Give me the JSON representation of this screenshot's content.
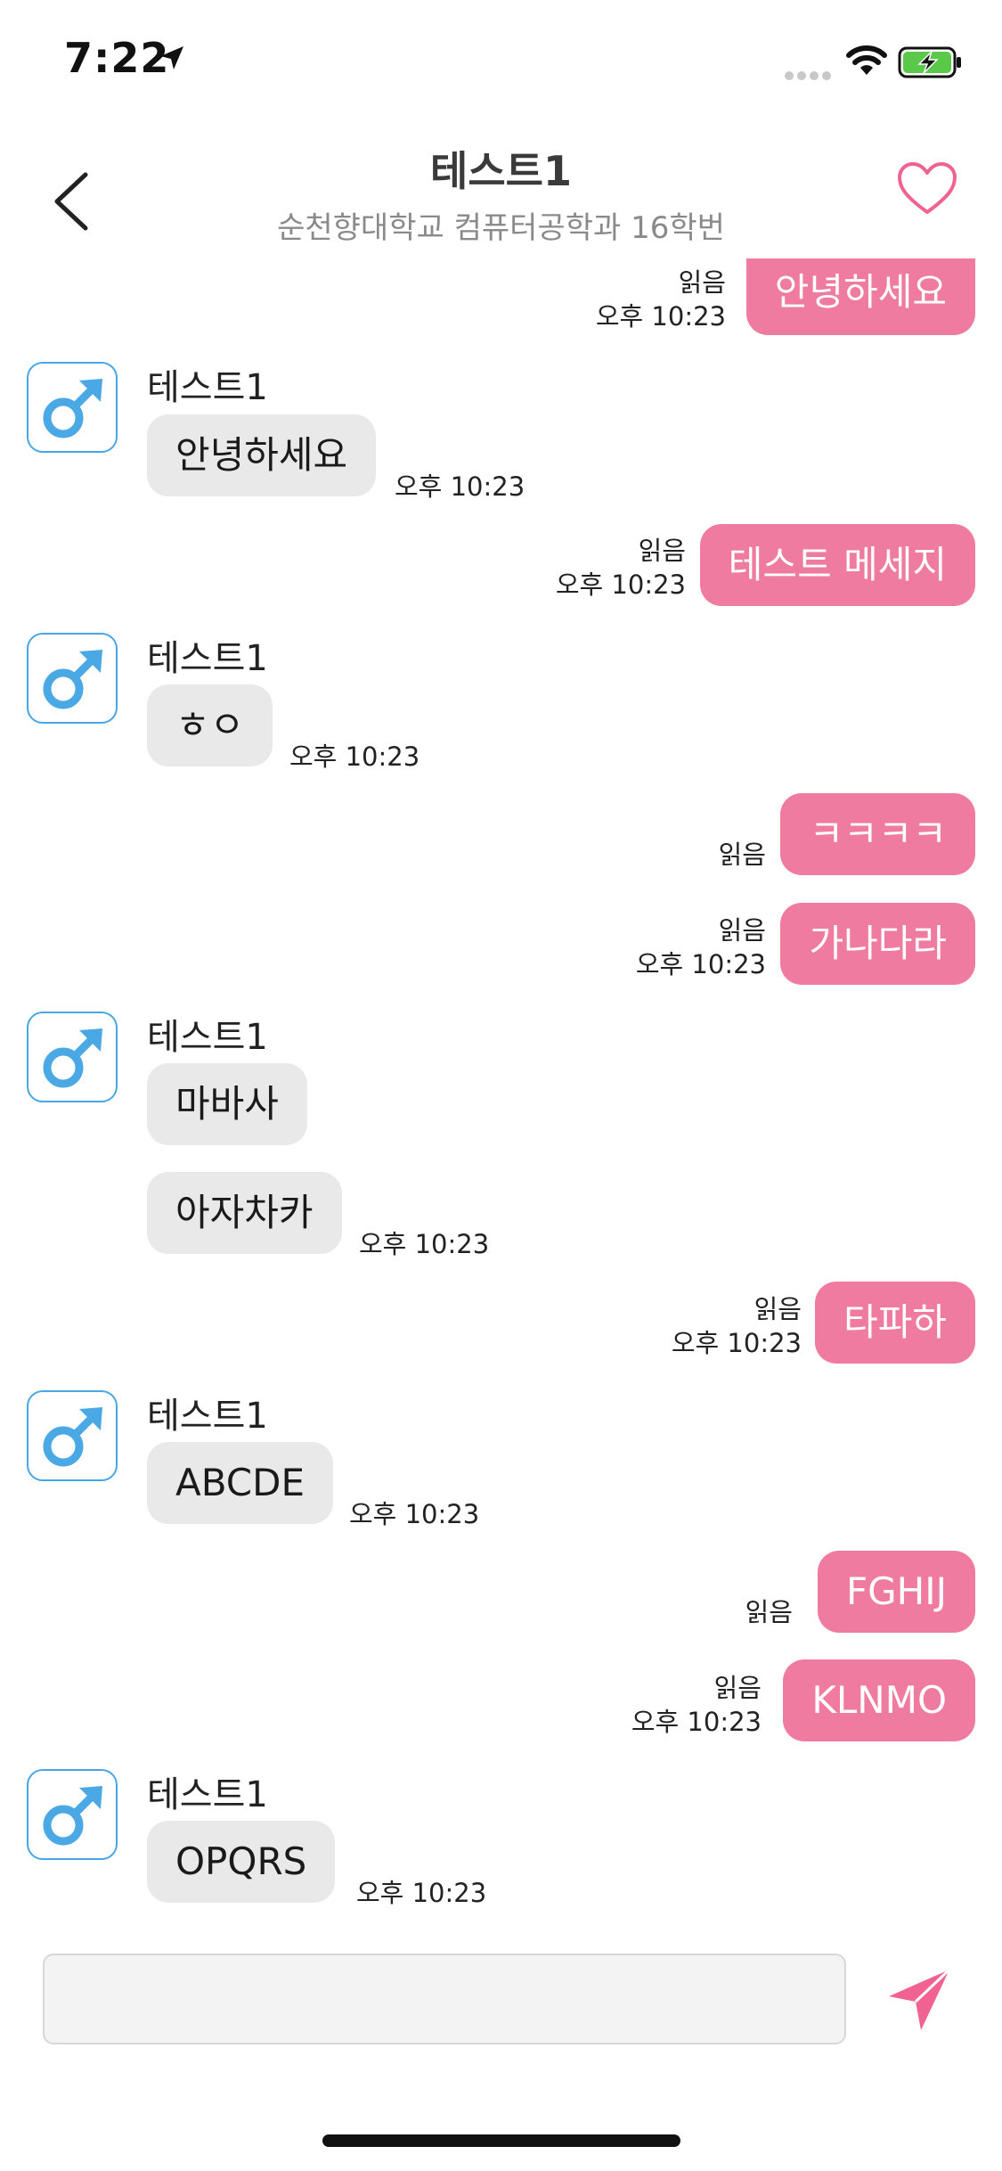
{
  "status_bar": {
    "time": "7:22"
  },
  "header": {
    "title": "테스트1",
    "subtitle": "순천향대학교 컴퓨터공학과 16학번"
  },
  "messages": [
    {
      "side": "out",
      "text": "안녕하세요",
      "read": "읽음",
      "time": "오후 10:23"
    },
    {
      "side": "in",
      "sender": "테스트1",
      "text": "안녕하세요",
      "time": "오후 10:23"
    },
    {
      "side": "out",
      "text": "테스트 메세지",
      "read": "읽음",
      "time": "오후 10:23"
    },
    {
      "side": "in",
      "sender": "테스트1",
      "text": "ㅎㅇ",
      "time": "오후 10:23"
    },
    {
      "side": "out",
      "text": "ㅋㅋㅋㅋ",
      "read": "읽음"
    },
    {
      "side": "out",
      "text": "가나다라",
      "read": "읽음",
      "time": "오후 10:23"
    },
    {
      "side": "in",
      "sender": "테스트1",
      "text": "마바사"
    },
    {
      "side": "in",
      "text": "아자차카",
      "time": "오후 10:23"
    },
    {
      "side": "out",
      "text": "타파하",
      "read": "읽음",
      "time": "오후 10:23"
    },
    {
      "side": "in",
      "sender": "테스트1",
      "text": "ABCDE",
      "time": "오후 10:23"
    },
    {
      "side": "out",
      "text": "FGHIJ",
      "read": "읽음"
    },
    {
      "side": "out",
      "text": "KLNMO",
      "read": "읽음",
      "time": "오후 10:23"
    },
    {
      "side": "in",
      "sender": "테스트1",
      "text": "OPQRS",
      "time": "오후 10:23"
    }
  ],
  "composer": {
    "placeholder": ""
  },
  "colors": {
    "outgoing_bubble": "#ef7ba0",
    "incoming_bubble": "#e9e9e9",
    "accent": "#f06292",
    "avatar_border": "#47a6e3",
    "avatar_icon": "#4aa8e4",
    "battery": "#5ac848"
  },
  "icons": {
    "back": "chevron-left-icon",
    "like": "heart-outline-icon",
    "avatar": "male-symbol-icon",
    "send": "paper-plane-icon",
    "location": "location-arrow-icon",
    "wifi": "wifi-icon",
    "battery": "battery-charging-icon"
  }
}
